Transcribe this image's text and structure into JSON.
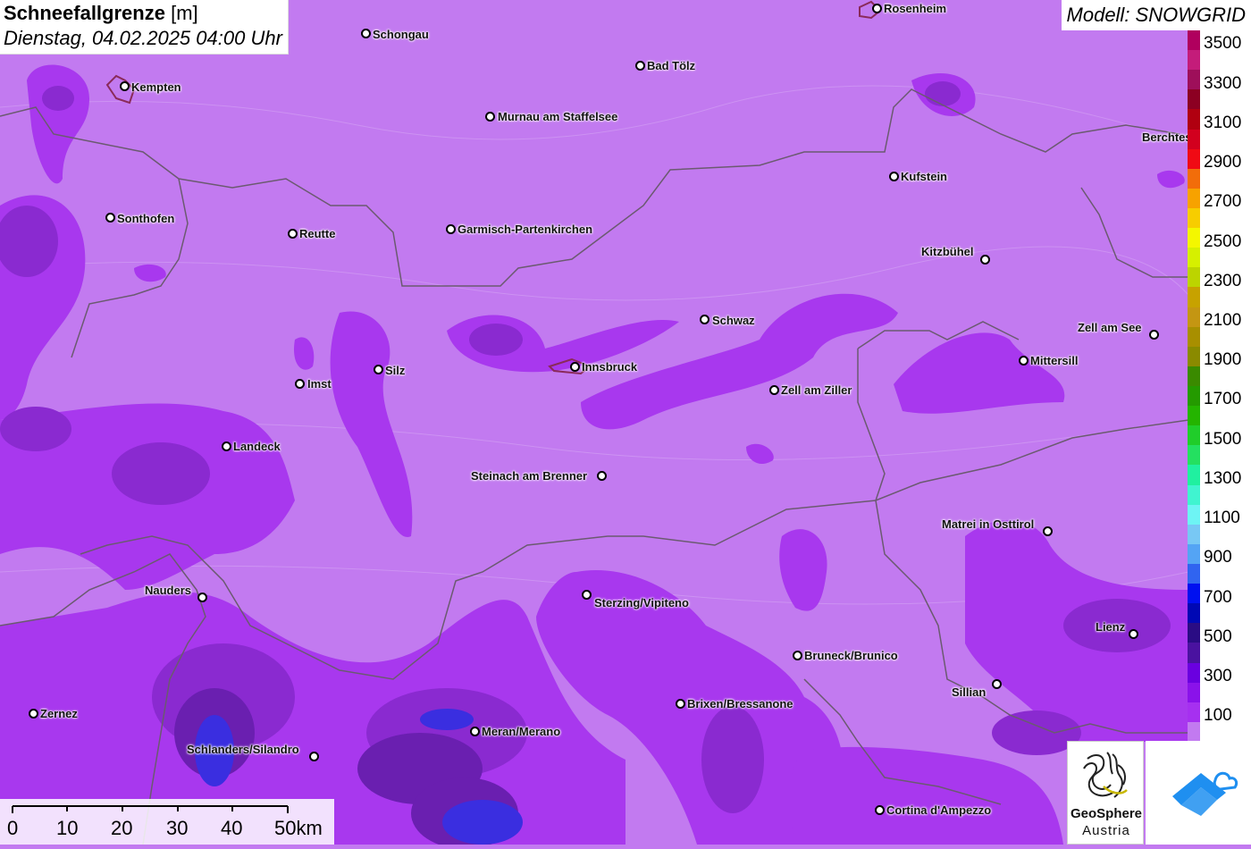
{
  "title": {
    "main_bold": "Schneefallgrenze",
    "main_unit": "[m]",
    "subtitle": "Dienstag, 04.02.2025 04:00 Uhr"
  },
  "model": "Modell: SNOWGRID",
  "cities": [
    {
      "name": "Schongau",
      "dot": "schongau"
    },
    {
      "name": "Rosenheim",
      "dot": "rosenheim"
    },
    {
      "name": "Kempten",
      "dot": "kempten"
    },
    {
      "name": "Bad Tölz",
      "dot": "badtoelz"
    },
    {
      "name": "Murnau am Staffelsee",
      "dot": "murnau"
    },
    {
      "name": "Berchtesgaden",
      "dot": "berchtesgaden"
    },
    {
      "name": "Kufstein",
      "dot": "kufstein"
    },
    {
      "name": "Sonthofen",
      "dot": "sonthofen"
    },
    {
      "name": "Reutte",
      "dot": "reutte"
    },
    {
      "name": "Garmisch-Partenkirchen",
      "dot": "garmisch"
    },
    {
      "name": "Kitzbühel",
      "dot": "kitzbuehel"
    },
    {
      "name": "Schwaz",
      "dot": "schwaz"
    },
    {
      "name": "Zell am See",
      "dot": "zellamsee"
    },
    {
      "name": "Mittersill",
      "dot": "mittersill"
    },
    {
      "name": "Silz",
      "dot": "silz"
    },
    {
      "name": "Innsbruck",
      "dot": "innsbruck"
    },
    {
      "name": "Imst",
      "dot": "imst"
    },
    {
      "name": "Zell am Ziller",
      "dot": "zellamziller"
    },
    {
      "name": "Landeck",
      "dot": "landeck"
    },
    {
      "name": "Steinach am Brenner",
      "dot": "steinach"
    },
    {
      "name": "Matrei in Osttirol",
      "dot": "matrei"
    },
    {
      "name": "Nauders",
      "dot": "nauders"
    },
    {
      "name": "Sterzing/Vipiteno",
      "dot": "sterzing"
    },
    {
      "name": "Lienz",
      "dot": "lienz"
    },
    {
      "name": "Bruneck/Brunico",
      "dot": "bruneck"
    },
    {
      "name": "Sillian",
      "dot": "sillian"
    },
    {
      "name": "Brixen/Bressanone",
      "dot": "brixen"
    },
    {
      "name": "Zernez",
      "dot": "zernez"
    },
    {
      "name": "Meran/Merano",
      "dot": "meran"
    },
    {
      "name": "Schlanders/Silandro",
      "dot": "schlanders"
    },
    {
      "name": "Cortina d'Ampezzo",
      "dot": "cortina"
    }
  ],
  "legend": {
    "labels": [
      "3500",
      "3300",
      "3100",
      "2900",
      "2700",
      "2500",
      "2300",
      "2100",
      "1900",
      "1700",
      "1500",
      "1300",
      "1100",
      "900",
      "700",
      "500",
      "300",
      "100"
    ],
    "colors": [
      "#b0005e",
      "#c41c7a",
      "#9e0f5a",
      "#8c0022",
      "#b00010",
      "#d2001e",
      "#f00a14",
      "#f26d0a",
      "#f7a200",
      "#f7cd00",
      "#f4f700",
      "#d6f000",
      "#bcd400",
      "#c7a200",
      "#c49612",
      "#a88f00",
      "#8a8a00",
      "#3a8a00",
      "#249a00",
      "#24b400",
      "#20cd2a",
      "#24e060",
      "#20f0a0",
      "#40f4d0",
      "#6ef4f4",
      "#78c8f4",
      "#54a4f4",
      "#3064f0",
      "#0010f0",
      "#0008b4",
      "#2a0c84",
      "#4a12a0",
      "#6a00e0",
      "#8a12ea",
      "#a630f0",
      "#c27af0"
    ]
  },
  "scale": {
    "labels": [
      "0",
      "10",
      "20",
      "30",
      "40",
      "50km"
    ]
  },
  "logo": {
    "name": "GeoSphere",
    "sub": "Austria"
  },
  "colors": {
    "background": "#c27af0",
    "zone_mid": "#a838ee",
    "zone_dark": "#8a2ad0",
    "zone_darker": "#6a1fb0",
    "zone_blue": "#3a2ee0",
    "border": "#6b5a70",
    "snowgrid_blue": "#1f8ff0"
  }
}
